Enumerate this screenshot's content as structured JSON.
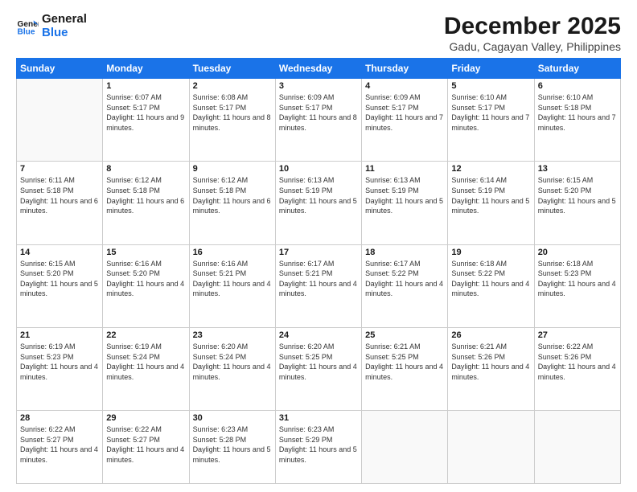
{
  "logo": {
    "line1": "General",
    "line2": "Blue"
  },
  "title": "December 2025",
  "subtitle": "Gadu, Cagayan Valley, Philippines",
  "days_header": [
    "Sunday",
    "Monday",
    "Tuesday",
    "Wednesday",
    "Thursday",
    "Friday",
    "Saturday"
  ],
  "weeks": [
    [
      {
        "day": "",
        "empty": true
      },
      {
        "day": "1",
        "sunrise": "6:07 AM",
        "sunset": "5:17 PM",
        "daylight": "11 hours and 9 minutes."
      },
      {
        "day": "2",
        "sunrise": "6:08 AM",
        "sunset": "5:17 PM",
        "daylight": "11 hours and 8 minutes."
      },
      {
        "day": "3",
        "sunrise": "6:09 AM",
        "sunset": "5:17 PM",
        "daylight": "11 hours and 8 minutes."
      },
      {
        "day": "4",
        "sunrise": "6:09 AM",
        "sunset": "5:17 PM",
        "daylight": "11 hours and 7 minutes."
      },
      {
        "day": "5",
        "sunrise": "6:10 AM",
        "sunset": "5:17 PM",
        "daylight": "11 hours and 7 minutes."
      },
      {
        "day": "6",
        "sunrise": "6:10 AM",
        "sunset": "5:18 PM",
        "daylight": "11 hours and 7 minutes."
      }
    ],
    [
      {
        "day": "7",
        "sunrise": "6:11 AM",
        "sunset": "5:18 PM",
        "daylight": "11 hours and 6 minutes."
      },
      {
        "day": "8",
        "sunrise": "6:12 AM",
        "sunset": "5:18 PM",
        "daylight": "11 hours and 6 minutes."
      },
      {
        "day": "9",
        "sunrise": "6:12 AM",
        "sunset": "5:18 PM",
        "daylight": "11 hours and 6 minutes."
      },
      {
        "day": "10",
        "sunrise": "6:13 AM",
        "sunset": "5:19 PM",
        "daylight": "11 hours and 5 minutes."
      },
      {
        "day": "11",
        "sunrise": "6:13 AM",
        "sunset": "5:19 PM",
        "daylight": "11 hours and 5 minutes."
      },
      {
        "day": "12",
        "sunrise": "6:14 AM",
        "sunset": "5:19 PM",
        "daylight": "11 hours and 5 minutes."
      },
      {
        "day": "13",
        "sunrise": "6:15 AM",
        "sunset": "5:20 PM",
        "daylight": "11 hours and 5 minutes."
      }
    ],
    [
      {
        "day": "14",
        "sunrise": "6:15 AM",
        "sunset": "5:20 PM",
        "daylight": "11 hours and 5 minutes."
      },
      {
        "day": "15",
        "sunrise": "6:16 AM",
        "sunset": "5:20 PM",
        "daylight": "11 hours and 4 minutes."
      },
      {
        "day": "16",
        "sunrise": "6:16 AM",
        "sunset": "5:21 PM",
        "daylight": "11 hours and 4 minutes."
      },
      {
        "day": "17",
        "sunrise": "6:17 AM",
        "sunset": "5:21 PM",
        "daylight": "11 hours and 4 minutes."
      },
      {
        "day": "18",
        "sunrise": "6:17 AM",
        "sunset": "5:22 PM",
        "daylight": "11 hours and 4 minutes."
      },
      {
        "day": "19",
        "sunrise": "6:18 AM",
        "sunset": "5:22 PM",
        "daylight": "11 hours and 4 minutes."
      },
      {
        "day": "20",
        "sunrise": "6:18 AM",
        "sunset": "5:23 PM",
        "daylight": "11 hours and 4 minutes."
      }
    ],
    [
      {
        "day": "21",
        "sunrise": "6:19 AM",
        "sunset": "5:23 PM",
        "daylight": "11 hours and 4 minutes."
      },
      {
        "day": "22",
        "sunrise": "6:19 AM",
        "sunset": "5:24 PM",
        "daylight": "11 hours and 4 minutes."
      },
      {
        "day": "23",
        "sunrise": "6:20 AM",
        "sunset": "5:24 PM",
        "daylight": "11 hours and 4 minutes."
      },
      {
        "day": "24",
        "sunrise": "6:20 AM",
        "sunset": "5:25 PM",
        "daylight": "11 hours and 4 minutes."
      },
      {
        "day": "25",
        "sunrise": "6:21 AM",
        "sunset": "5:25 PM",
        "daylight": "11 hours and 4 minutes."
      },
      {
        "day": "26",
        "sunrise": "6:21 AM",
        "sunset": "5:26 PM",
        "daylight": "11 hours and 4 minutes."
      },
      {
        "day": "27",
        "sunrise": "6:22 AM",
        "sunset": "5:26 PM",
        "daylight": "11 hours and 4 minutes."
      }
    ],
    [
      {
        "day": "28",
        "sunrise": "6:22 AM",
        "sunset": "5:27 PM",
        "daylight": "11 hours and 4 minutes."
      },
      {
        "day": "29",
        "sunrise": "6:22 AM",
        "sunset": "5:27 PM",
        "daylight": "11 hours and 4 minutes."
      },
      {
        "day": "30",
        "sunrise": "6:23 AM",
        "sunset": "5:28 PM",
        "daylight": "11 hours and 5 minutes."
      },
      {
        "day": "31",
        "sunrise": "6:23 AM",
        "sunset": "5:29 PM",
        "daylight": "11 hours and 5 minutes."
      },
      {
        "day": "",
        "empty": true
      },
      {
        "day": "",
        "empty": true
      },
      {
        "day": "",
        "empty": true
      }
    ]
  ]
}
